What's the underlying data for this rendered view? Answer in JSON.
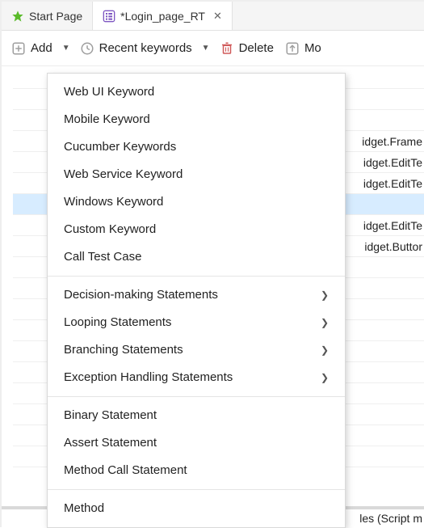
{
  "tabs": [
    {
      "label": "Start Page",
      "icon": "star"
    },
    {
      "label": "*Login_page_RT",
      "icon": "list",
      "active": true,
      "closable": true
    }
  ],
  "toolbar": {
    "add_label": "Add",
    "recent_label": "Recent keywords",
    "delete_label": "Delete",
    "move_label": "Mo"
  },
  "grid_rows": [
    {
      "text": "",
      "sel": false
    },
    {
      "text": "",
      "sel": false
    },
    {
      "text": "",
      "sel": false
    },
    {
      "text": "idget.Frame",
      "sel": false
    },
    {
      "text": "idget.EditTe",
      "sel": false
    },
    {
      "text": "idget.EditTe",
      "sel": false
    },
    {
      "text": "",
      "sel": true
    },
    {
      "text": "idget.EditTe",
      "sel": false
    },
    {
      "text": "idget.Buttor",
      "sel": false
    },
    {
      "text": "",
      "sel": false
    },
    {
      "text": "",
      "sel": false
    },
    {
      "text": "",
      "sel": false
    },
    {
      "text": "",
      "sel": false
    },
    {
      "text": "",
      "sel": false
    },
    {
      "text": "",
      "sel": false
    },
    {
      "text": "",
      "sel": false
    },
    {
      "text": "",
      "sel": false
    },
    {
      "text": "",
      "sel": false
    },
    {
      "text": "",
      "sel": false
    }
  ],
  "footer_text": "les (Script m",
  "menu": {
    "groups": [
      [
        {
          "label": "Web UI Keyword",
          "submenu": false
        },
        {
          "label": "Mobile Keyword",
          "submenu": false
        },
        {
          "label": "Cucumber Keywords",
          "submenu": false
        },
        {
          "label": "Web Service Keyword",
          "submenu": false
        },
        {
          "label": "Windows Keyword",
          "submenu": false
        },
        {
          "label": "Custom Keyword",
          "submenu": false
        },
        {
          "label": "Call Test Case",
          "submenu": false
        }
      ],
      [
        {
          "label": "Decision-making Statements",
          "submenu": true
        },
        {
          "label": "Looping Statements",
          "submenu": true
        },
        {
          "label": "Branching Statements",
          "submenu": true
        },
        {
          "label": "Exception Handling Statements",
          "submenu": true
        }
      ],
      [
        {
          "label": "Binary Statement",
          "submenu": false
        },
        {
          "label": "Assert Statement",
          "submenu": false
        },
        {
          "label": "Method Call Statement",
          "submenu": false
        }
      ],
      [
        {
          "label": "Method",
          "submenu": false
        }
      ]
    ]
  }
}
